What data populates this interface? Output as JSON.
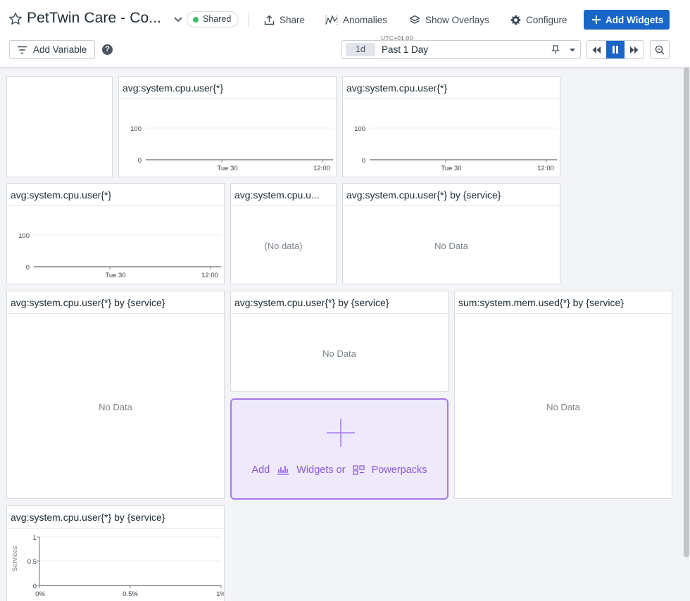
{
  "header": {
    "title": "PetTwin Care - Co...",
    "shared_label": "Shared",
    "share_label": "Share",
    "anomalies_label": "Anomalies",
    "overlays_label": "Show Overlays",
    "configure_label": "Configure",
    "add_widgets_label": "Add Widgets",
    "add_variable_label": "Add Variable",
    "help_glyph": "?",
    "timezone": "UTC+01:00",
    "time_badge": "1d",
    "time_label": "Past 1 Day",
    "colors": {
      "accent": "#1866c7",
      "shared_dot": "#3cbf6c"
    }
  },
  "widgets": [
    {
      "title": "",
      "kind": "empty"
    },
    {
      "title": "avg:system.cpu.user{*}",
      "kind": "timeseries",
      "yticks": [
        "100",
        "0"
      ],
      "xticks": [
        "Tue 30",
        "12:00"
      ]
    },
    {
      "title": "avg:system.cpu.user{*}",
      "kind": "timeseries",
      "yticks": [
        "100",
        "0"
      ],
      "xticks": [
        "Tue 30",
        "12:00"
      ]
    },
    {
      "title": "avg:system.cpu.user{*}",
      "kind": "timeseries",
      "yticks": [
        "100",
        "0"
      ],
      "xticks": [
        "Tue 30",
        "12:00"
      ]
    },
    {
      "title": "avg:system.cpu.u...",
      "kind": "message",
      "message": "(No data)"
    },
    {
      "title": "avg:system.cpu.user{*} by {service}",
      "kind": "message",
      "message": "No Data"
    },
    {
      "title": "avg:system.cpu.user{*} by {service}",
      "kind": "message",
      "message": "No Data"
    },
    {
      "title": "avg:system.cpu.user{*} by {service}",
      "kind": "message",
      "message": "No Data"
    },
    {
      "title": "sum:system.mem.used{*} by {service}",
      "kind": "message",
      "message": "No Data"
    },
    {
      "title": "avg:system.cpu.user{*} by {service}",
      "kind": "distribution",
      "ylabel": "Services",
      "yticks": [
        "1",
        "0.5",
        "0"
      ],
      "xticks": [
        "0%",
        "0.5%",
        "1%"
      ]
    }
  ],
  "add_placeholder": {
    "add_label": "Add",
    "widgets_label": "Widgets or",
    "powerpacks_label": "Powerpacks",
    "color": "#8b55e0"
  }
}
